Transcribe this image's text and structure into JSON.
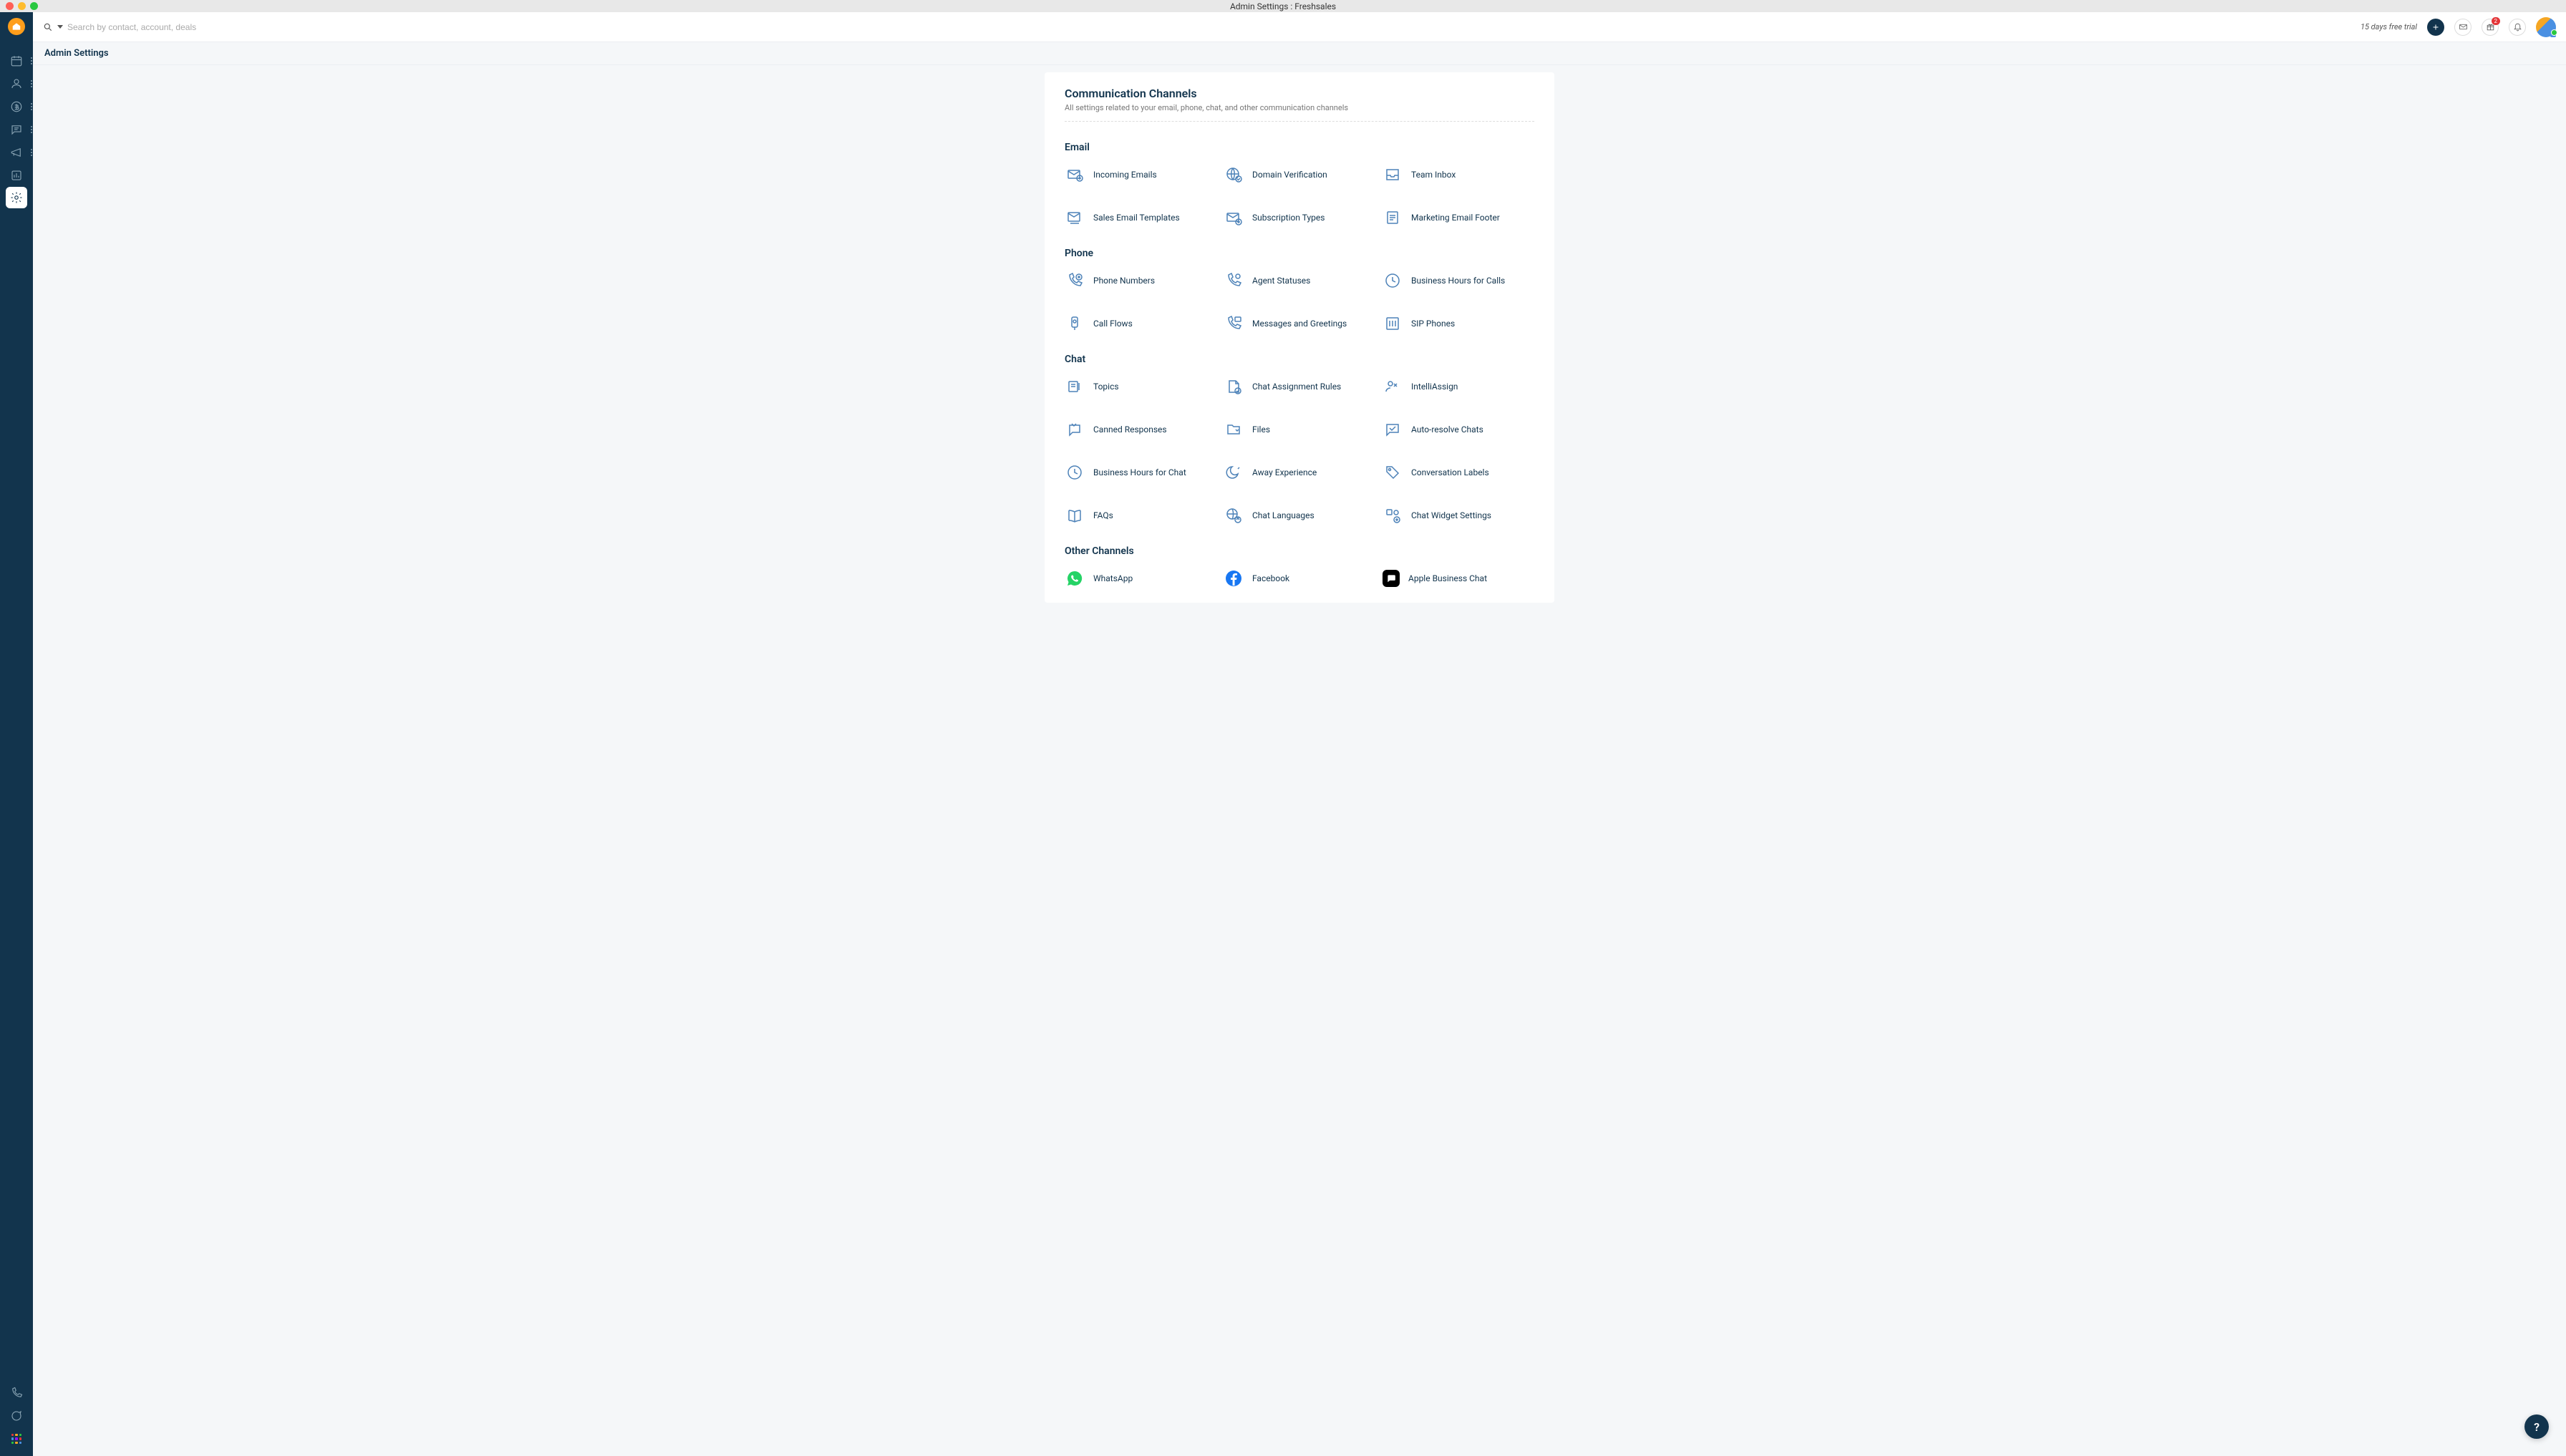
{
  "window": {
    "title": "Admin Settings : Freshsales"
  },
  "topbar": {
    "search_placeholder": "Search by contact, account, deals",
    "trial_text": "15 days free trial",
    "notification_count": "2"
  },
  "page": {
    "title": "Admin Settings"
  },
  "section": {
    "title": "Communication Channels",
    "description": "All settings related to your email, phone, chat, and other communication channels"
  },
  "groups": [
    {
      "title": "Email",
      "items": [
        {
          "label": "Incoming Emails",
          "icon": "mail-in"
        },
        {
          "label": "Domain Verification",
          "icon": "globe-check"
        },
        {
          "label": "Team Inbox",
          "icon": "inbox"
        },
        {
          "label": "Sales Email Templates",
          "icon": "mail-template"
        },
        {
          "label": "Subscription Types",
          "icon": "mail-plus"
        },
        {
          "label": "Marketing Email Footer",
          "icon": "doc-lines"
        }
      ]
    },
    {
      "title": "Phone",
      "items": [
        {
          "label": "Phone Numbers",
          "icon": "phone-plus"
        },
        {
          "label": "Agent Statuses",
          "icon": "phone-status"
        },
        {
          "label": "Business Hours for Calls",
          "icon": "clock"
        },
        {
          "label": "Call Flows",
          "icon": "flow"
        },
        {
          "label": "Messages and Greetings",
          "icon": "phone-msg"
        },
        {
          "label": "SIP Phones",
          "icon": "sip"
        }
      ]
    },
    {
      "title": "Chat",
      "items": [
        {
          "label": "Topics",
          "icon": "topics"
        },
        {
          "label": "Chat Assignment Rules",
          "icon": "doc-rules"
        },
        {
          "label": "IntelliAssign",
          "icon": "person-assign"
        },
        {
          "label": "Canned Responses",
          "icon": "canned"
        },
        {
          "label": "Files",
          "icon": "folder"
        },
        {
          "label": "Auto-resolve Chats",
          "icon": "chat-check"
        },
        {
          "label": "Business Hours for Chat",
          "icon": "clock"
        },
        {
          "label": "Away Experience",
          "icon": "moon"
        },
        {
          "label": "Conversation Labels",
          "icon": "tag"
        },
        {
          "label": "FAQs",
          "icon": "book"
        },
        {
          "label": "Chat Languages",
          "icon": "lang"
        },
        {
          "label": "Chat Widget Settings",
          "icon": "widget"
        }
      ]
    },
    {
      "title": "Other Channels",
      "items": [
        {
          "label": "WhatsApp",
          "icon": "whatsapp"
        },
        {
          "label": "Facebook",
          "icon": "facebook"
        },
        {
          "label": "Apple Business Chat",
          "icon": "apple"
        }
      ]
    }
  ],
  "help_label": "?"
}
